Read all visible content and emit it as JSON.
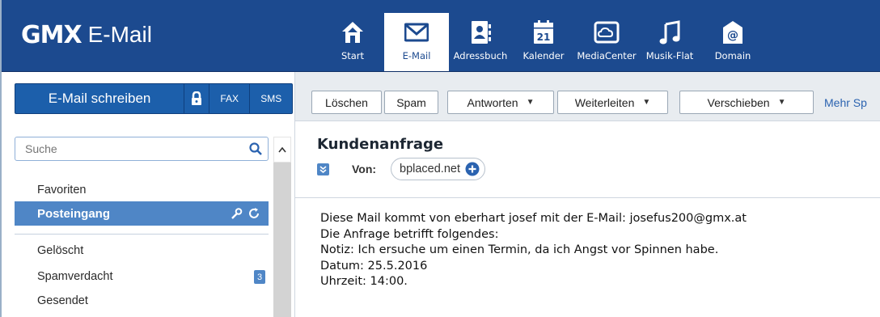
{
  "header": {
    "brand": "GMX",
    "product": "E-Mail",
    "nav": [
      {
        "label": "Start",
        "icon": "home-icon"
      },
      {
        "label": "E-Mail",
        "icon": "envelope-icon",
        "selected": true
      },
      {
        "label": "Adressbuch",
        "icon": "addressbook-icon"
      },
      {
        "label": "Kalender",
        "icon": "calendar-icon",
        "day": "21"
      },
      {
        "label": "MediaCenter",
        "icon": "cloud-icon"
      },
      {
        "label": "Musik-Flat",
        "icon": "music-note-icon"
      },
      {
        "label": "Domain",
        "icon": "at-sign-icon"
      }
    ]
  },
  "sidebar": {
    "compose_label": "E-Mail schreiben",
    "fax_label": "FAX",
    "sms_label": "SMS",
    "search_placeholder": "Suche",
    "folders": {
      "favoriten": "Favoriten",
      "posteingang": "Posteingang",
      "geloescht": "Gelöscht",
      "spamverdacht": "Spamverdacht",
      "spam_count": "3",
      "gesendet": "Gesendet"
    }
  },
  "toolbar": {
    "delete": "Löschen",
    "spam": "Spam",
    "reply": "Antworten",
    "forward": "Weiterleiten",
    "move": "Verschieben",
    "more": "Mehr Sp"
  },
  "message": {
    "subject": "Kundenanfrage",
    "from_label": "Von:",
    "from_sender": "bplaced.net",
    "body": [
      "Diese Mail kommt von eberhart josef mit der E-Mail: josefus200@gmx.at",
      "Die Anfrage betrifft folgendes:",
      "Notiz: Ich ersuche um einen Termin, da ich Angst vor Spinnen habe.",
      "Datum: 25.5.2016",
      "Uhrzeit: 14:00."
    ]
  },
  "colors": {
    "header_bg": "#1c4a8f",
    "accent": "#4f86c6",
    "compose_bg": "#1c5fab"
  }
}
